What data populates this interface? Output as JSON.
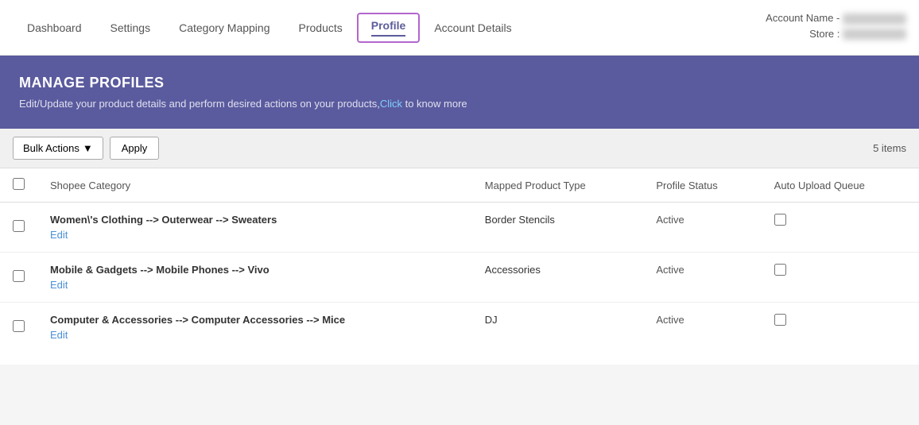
{
  "nav": {
    "items": [
      {
        "label": "Dashboard",
        "active": false
      },
      {
        "label": "Settings",
        "active": false
      },
      {
        "label": "Category Mapping",
        "active": false
      },
      {
        "label": "Products",
        "active": false
      },
      {
        "label": "Profile",
        "active": true
      },
      {
        "label": "Account Details",
        "active": false
      }
    ]
  },
  "account": {
    "name_label": "Account Name -",
    "store_label": "Store :"
  },
  "banner": {
    "title": "MANAGE PROFILES",
    "description": "Edit/Update your product details and perform desired actions on your products,",
    "link_text": "Click",
    "description_end": " to know more"
  },
  "toolbar": {
    "bulk_actions_label": "Bulk Actions",
    "apply_label": "Apply",
    "items_count": "5 items"
  },
  "table": {
    "headers": [
      "",
      "Shopee Category",
      "Mapped Product Type",
      "Profile Status",
      "Auto Upload Queue"
    ],
    "rows": [
      {
        "category": "Women\\'s Clothing --> Outerwear --> Sweaters",
        "mapped_type": "Border Stencils",
        "status": "Active",
        "edit_label": "Edit"
      },
      {
        "category": "Mobile & Gadgets --> Mobile Phones --> Vivo",
        "mapped_type": "Accessories",
        "status": "Active",
        "edit_label": "Edit"
      },
      {
        "category": "Computer & Accessories --> Computer Accessories --> Mice",
        "mapped_type": "DJ",
        "status": "Active",
        "edit_label": "Edit"
      }
    ]
  }
}
